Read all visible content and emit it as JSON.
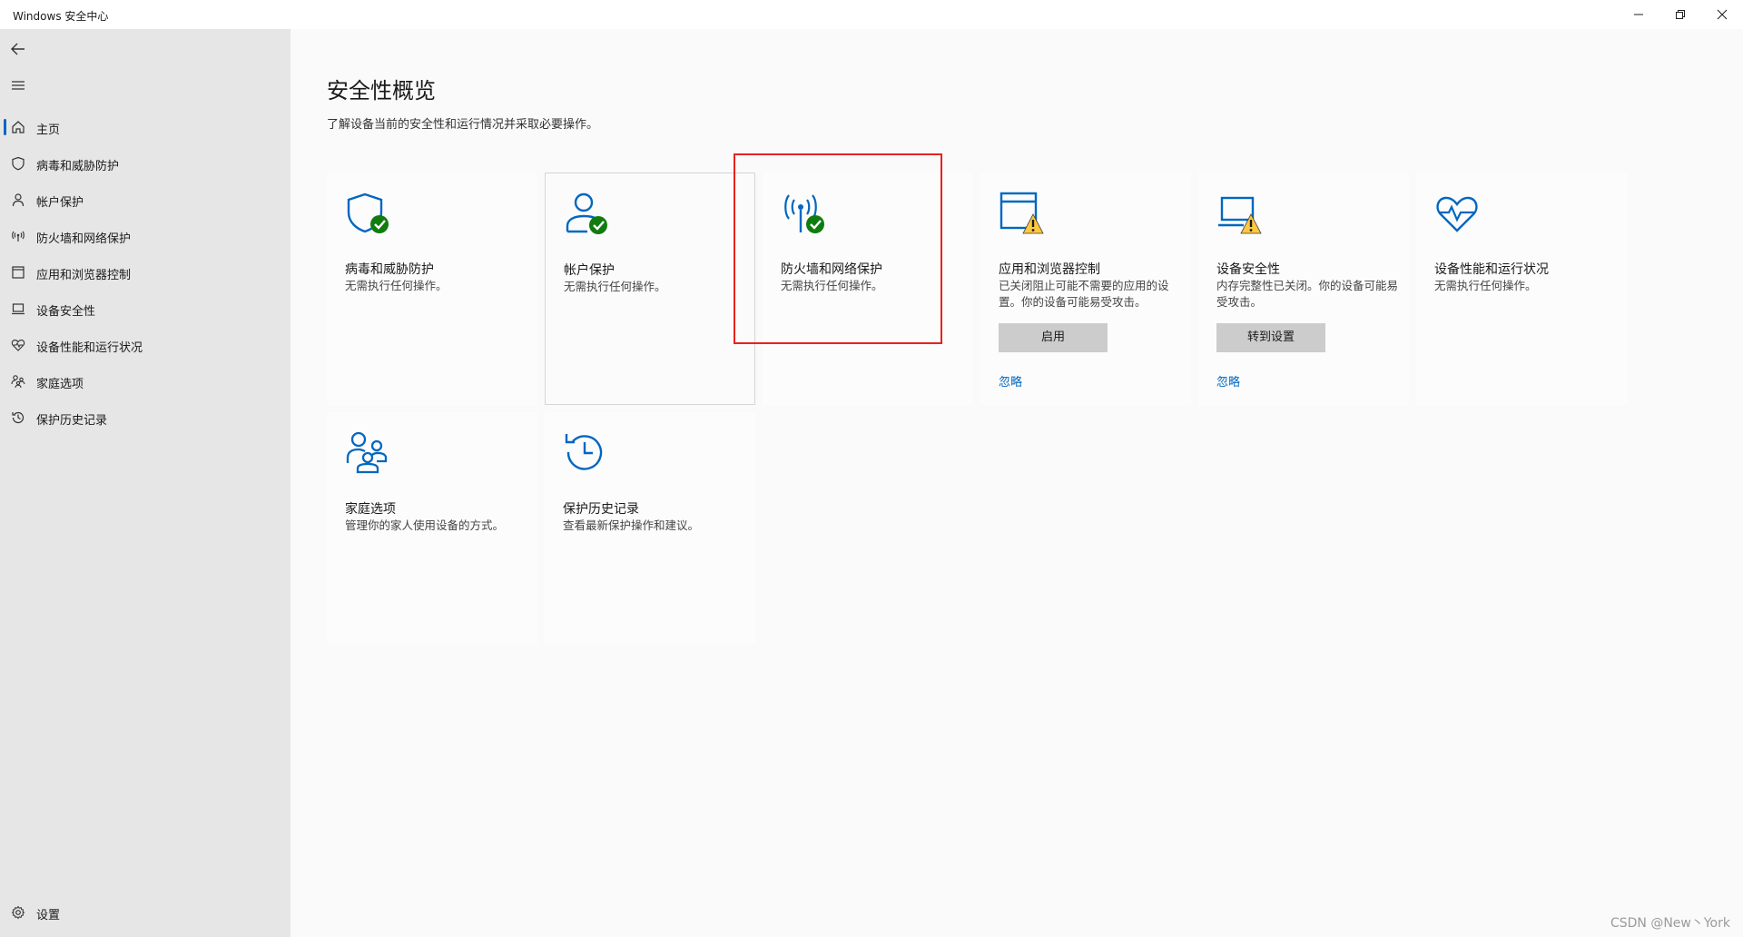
{
  "window": {
    "title": "Windows 安全中心",
    "controls": {
      "minimize": "—",
      "restore": "❐",
      "close": "✕"
    }
  },
  "sidebar": {
    "back_icon": "back-arrow-icon",
    "menu_icon": "hamburger-menu-icon",
    "items": [
      {
        "label": "主页",
        "icon": "home-icon",
        "active": true
      },
      {
        "label": "病毒和威胁防护",
        "icon": "shield-icon"
      },
      {
        "label": "帐户保护",
        "icon": "person-icon"
      },
      {
        "label": "防火墙和网络保护",
        "icon": "antenna-icon"
      },
      {
        "label": "应用和浏览器控制",
        "icon": "app-window-icon"
      },
      {
        "label": "设备安全性",
        "icon": "laptop-icon"
      },
      {
        "label": "设备性能和运行状况",
        "icon": "heart-pulse-icon"
      },
      {
        "label": "家庭选项",
        "icon": "family-icon"
      },
      {
        "label": "保护历史记录",
        "icon": "history-icon"
      }
    ],
    "settings": {
      "label": "设置",
      "icon": "gear-icon"
    }
  },
  "main": {
    "title": "安全性概览",
    "subtitle": "了解设备当前的安全性和运行情况并采取必要操作。",
    "cards": [
      {
        "title": "病毒和威胁防护",
        "desc": "无需执行任何操作。",
        "status": "ok"
      },
      {
        "title": "帐户保护",
        "desc": "无需执行任何操作。",
        "status": "ok"
      },
      {
        "title": "防火墙和网络保护",
        "desc": "无需执行任何操作。",
        "status": "ok"
      },
      {
        "title": "应用和浏览器控制",
        "desc": "已关闭阻止可能不需要的应用的设置。你的设备可能易受攻击。",
        "status": "warning",
        "button": "启用",
        "link": "忽略"
      },
      {
        "title": "设备安全性",
        "desc": "内存完整性已关闭。你的设备可能易受攻击。",
        "status": "warning",
        "button": "转到设置",
        "link": "忽略"
      },
      {
        "title": "设备性能和运行状况",
        "desc": "无需执行任何操作。",
        "status": "none"
      },
      {
        "title": "家庭选项",
        "desc": "管理你的家人使用设备的方式。",
        "status": "none"
      },
      {
        "title": "保护历史记录",
        "desc": "查看最新保护操作和建议。",
        "status": "none"
      }
    ]
  },
  "colors": {
    "accent": "#0067c0",
    "ok": "#107c10",
    "warning": "#ffc83d",
    "highlight": "#e8211e"
  },
  "watermark": "CSDN @New丶York"
}
